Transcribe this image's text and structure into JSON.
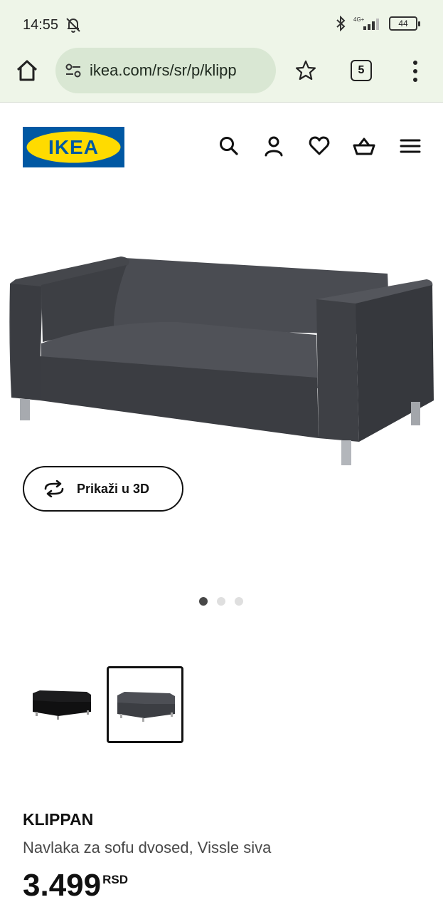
{
  "status_bar": {
    "time": "14:55",
    "network": "4G+",
    "battery": "44"
  },
  "browser": {
    "url": "ikea.com/rs/sr/p/klipp",
    "tab_count": "5"
  },
  "header": {
    "logo_text": "IKEA",
    "icons": [
      "search-icon",
      "user-icon",
      "heart-icon",
      "basket-icon",
      "hamburger-menu-icon"
    ]
  },
  "gallery": {
    "view_3d_label": "Prikaži u 3D",
    "image_count": 3,
    "active_index": 0,
    "thumbnail_count": 2,
    "selected_thumbnail": 1
  },
  "product": {
    "name": "KLIPPAN",
    "description": "Navlaka za sofu dvosed, Vissle siva",
    "price": "3.499",
    "currency": "RSD"
  },
  "colors": {
    "ikea_blue": "#0058a3",
    "ikea_yellow": "#ffdb00",
    "browser_chrome": "#eef5e8"
  }
}
